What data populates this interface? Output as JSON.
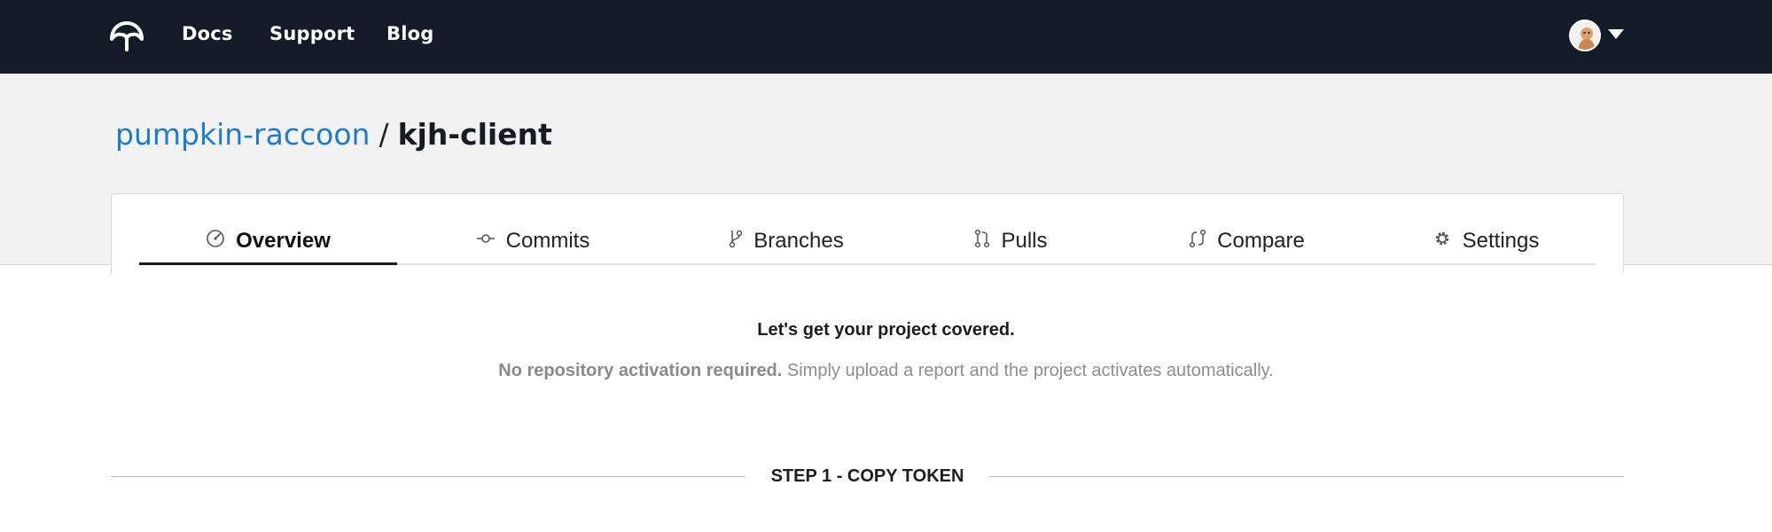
{
  "nav": {
    "logo_icon": "codecov-umbrella-icon",
    "links": [
      {
        "label": "Docs"
      },
      {
        "label": "Support"
      },
      {
        "label": "Blog"
      }
    ],
    "avatar_icon": "user-avatar-icon",
    "menu_icon": "caret-down-icon"
  },
  "breadcrumb": {
    "owner": "pumpkin-raccoon",
    "separator": "/",
    "repo": "kjh-client"
  },
  "tabs": [
    {
      "label": "Overview",
      "icon": "gauge-icon",
      "active": true
    },
    {
      "label": "Commits",
      "icon": "commit-icon",
      "active": false
    },
    {
      "label": "Branches",
      "icon": "branch-icon",
      "active": false
    },
    {
      "label": "Pulls",
      "icon": "pull-request-icon",
      "active": false
    },
    {
      "label": "Compare",
      "icon": "compare-icon",
      "active": false
    },
    {
      "label": "Settings",
      "icon": "gear-icon",
      "active": false
    }
  ],
  "main": {
    "headline": "Let's get your project covered.",
    "sub_bold": "No repository activation required.",
    "sub_rest": " Simply upload a report and the project activates automatically.",
    "step_label": "STEP 1 - COPY TOKEN"
  },
  "colors": {
    "nav_bg": "#131b29",
    "link_blue": "#1f7ccb",
    "band_bg": "#f2f2f2"
  }
}
